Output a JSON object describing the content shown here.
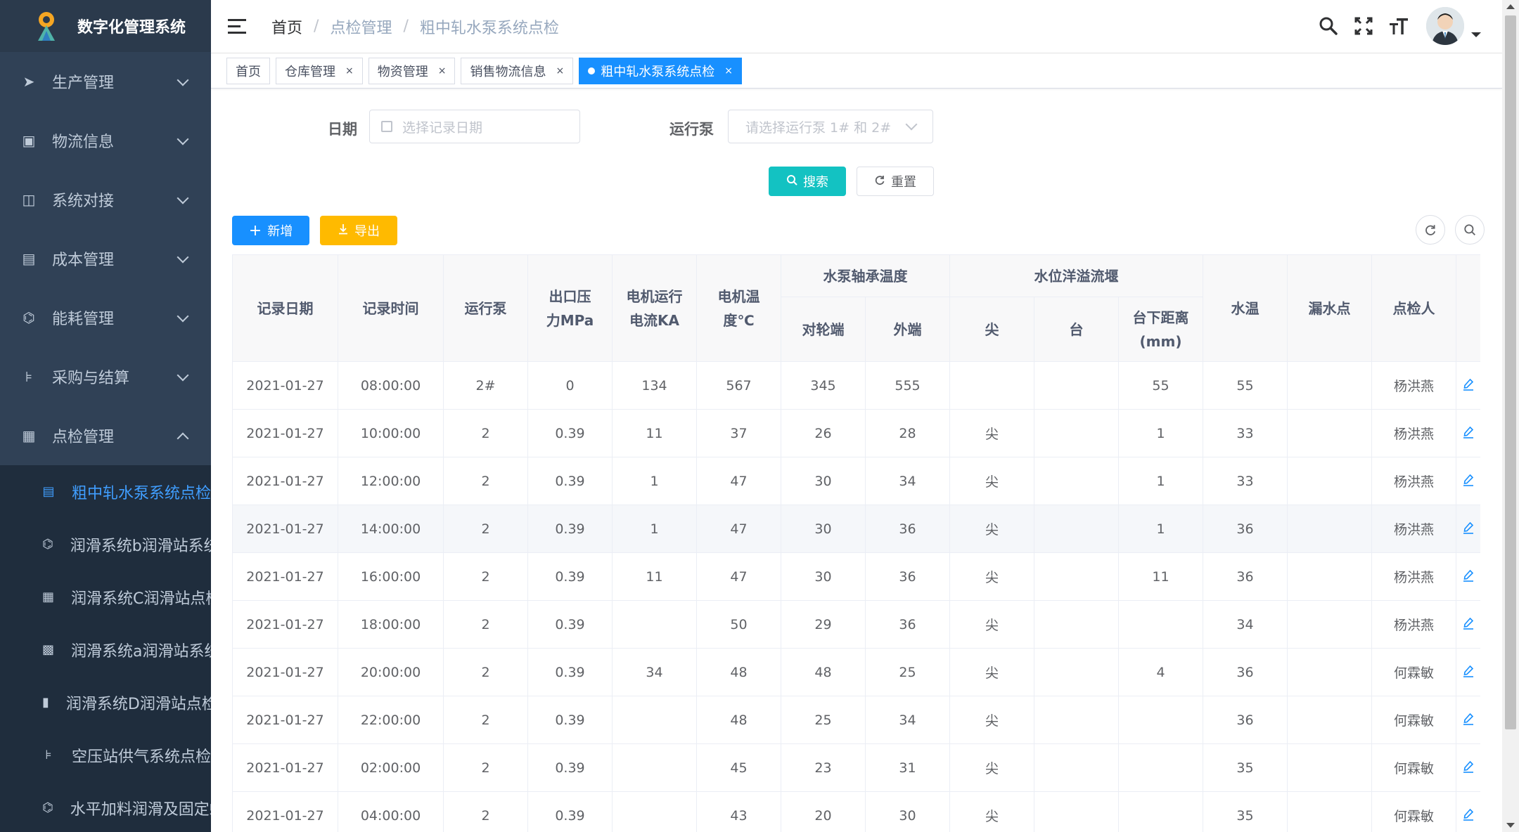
{
  "app": {
    "title": "数字化管理系统"
  },
  "sidebar": {
    "menus": [
      {
        "label": "生产管理",
        "icon": "paper-plane-icon"
      },
      {
        "label": "物流信息",
        "icon": "image-frame-icon"
      },
      {
        "label": "系统对接",
        "icon": "columns-icon"
      },
      {
        "label": "成本管理",
        "icon": "document-icon"
      },
      {
        "label": "能耗管理",
        "icon": "plugin-icon"
      },
      {
        "label": "采购与结算",
        "icon": "tree-icon"
      },
      {
        "label": "点检管理",
        "icon": "table-icon"
      }
    ],
    "submenu": [
      {
        "label": "粗中轧水泵系统点检",
        "icon": "list-icon",
        "active": true
      },
      {
        "label": "润滑系统b润滑站系统",
        "icon": "plugin-icon"
      },
      {
        "label": "润滑系统C润滑站点检",
        "icon": "table-icon"
      },
      {
        "label": "润滑系统a润滑站系统",
        "icon": "image-icon"
      },
      {
        "label": "润滑系统D润滑站点检",
        "icon": "bar-chart-icon"
      },
      {
        "label": "空压站供气系统点检",
        "icon": "tree-icon"
      },
      {
        "label": "水平加料润滑及固定螺",
        "icon": "plugin-icon"
      }
    ]
  },
  "header": {
    "breadcrumb": [
      "首页",
      "点检管理",
      "粗中轧水泵系统点检"
    ]
  },
  "tags": [
    {
      "label": "首页",
      "closable": false
    },
    {
      "label": "仓库管理",
      "closable": true
    },
    {
      "label": "物资管理",
      "closable": true
    },
    {
      "label": "销售物流信息",
      "closable": true
    },
    {
      "label": "粗中轧水泵系统点检",
      "closable": true,
      "active": true
    }
  ],
  "tag_close": "×",
  "search": {
    "date_label": "日期",
    "date_placeholder": "选择记录日期",
    "pump_label": "运行泵",
    "pump_placeholder": "请选择运行泵 1# 和 2#",
    "search_button": "搜索",
    "reset_button": "重置"
  },
  "toolbar": {
    "add_button": "新增",
    "export_button": "导出"
  },
  "table": {
    "headers": {
      "date": "记录日期",
      "time": "记录时间",
      "pump": "运行泵",
      "pressure": "出口压力MPa",
      "current": "电机运行电流KA",
      "motor_temp": "电机温度℃",
      "bearing_group": "水泵轴承温度",
      "bearing_wheel": "对轮端",
      "bearing_outer": "外端",
      "weir_group": "水位洋溢流堰",
      "weir_tip": "尖",
      "weir_platform": "台",
      "weir_distance": "台下距离(mm)",
      "water_temp": "水温",
      "leak": "漏水点",
      "inspector": "点检人"
    },
    "rows": [
      [
        "2021-01-27",
        "08:00:00",
        "2#",
        "0",
        "134",
        "567",
        "345",
        "555",
        "",
        "",
        "55",
        "55",
        "",
        "杨洪燕"
      ],
      [
        "2021-01-27",
        "10:00:00",
        "2",
        "0.39",
        "11",
        "37",
        "26",
        "28",
        "尖",
        "",
        "1",
        "33",
        "",
        "杨洪燕"
      ],
      [
        "2021-01-27",
        "12:00:00",
        "2",
        "0.39",
        "1",
        "47",
        "30",
        "34",
        "尖",
        "",
        "1",
        "33",
        "",
        "杨洪燕"
      ],
      [
        "2021-01-27",
        "14:00:00",
        "2",
        "0.39",
        "1",
        "47",
        "30",
        "36",
        "尖",
        "",
        "1",
        "36",
        "",
        "杨洪燕"
      ],
      [
        "2021-01-27",
        "16:00:00",
        "2",
        "0.39",
        "11",
        "47",
        "30",
        "36",
        "尖",
        "",
        "11",
        "36",
        "",
        "杨洪燕"
      ],
      [
        "2021-01-27",
        "18:00:00",
        "2",
        "0.39",
        "",
        "50",
        "29",
        "36",
        "尖",
        "",
        "",
        "34",
        "",
        "杨洪燕"
      ],
      [
        "2021-01-27",
        "20:00:00",
        "2",
        "0.39",
        "34",
        "48",
        "48",
        "25",
        "尖",
        "",
        "4",
        "36",
        "",
        "何霖敏"
      ],
      [
        "2021-01-27",
        "22:00:00",
        "2",
        "0.39",
        "",
        "48",
        "25",
        "34",
        "尖",
        "",
        "",
        "36",
        "",
        "何霖敏"
      ],
      [
        "2021-01-27",
        "02:00:00",
        "2",
        "0.39",
        "",
        "45",
        "23",
        "31",
        "尖",
        "",
        "",
        "35",
        "",
        "何霖敏"
      ],
      [
        "2021-01-27",
        "04:00:00",
        "2",
        "0.39",
        "",
        "43",
        "20",
        "30",
        "尖",
        "",
        "",
        "35",
        "",
        "何霖敏"
      ]
    ]
  },
  "colors": {
    "sidebar_bg": "#304156",
    "primary": "#1890ff",
    "search_btn": "#13c2c2",
    "export_btn": "#ffba00"
  }
}
